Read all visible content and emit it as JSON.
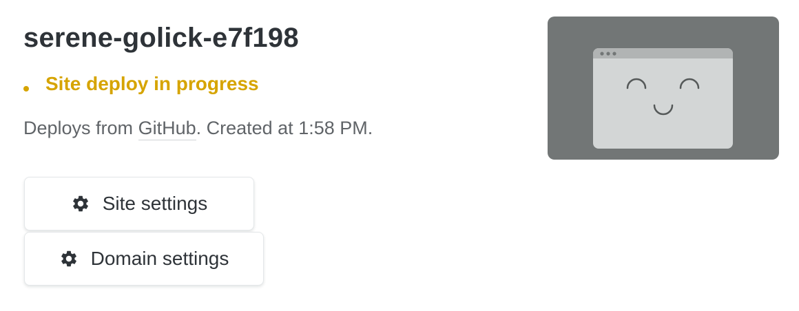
{
  "site": {
    "title": "serene-golick-e7f198",
    "status": "Site deploy in progress",
    "status_color": "#d6a400",
    "meta_prefix": "Deploys from ",
    "meta_link": "GitHub",
    "meta_suffix": ". Created at 1:58 PM."
  },
  "actions": {
    "site_settings_label": "Site settings",
    "site_settings_icon": "gear-icon",
    "domain_settings_label": "Domain settings",
    "domain_settings_icon": "gear-icon"
  },
  "preview": {
    "icon": "smiling-browser-window-illustration",
    "background": "#727676"
  }
}
